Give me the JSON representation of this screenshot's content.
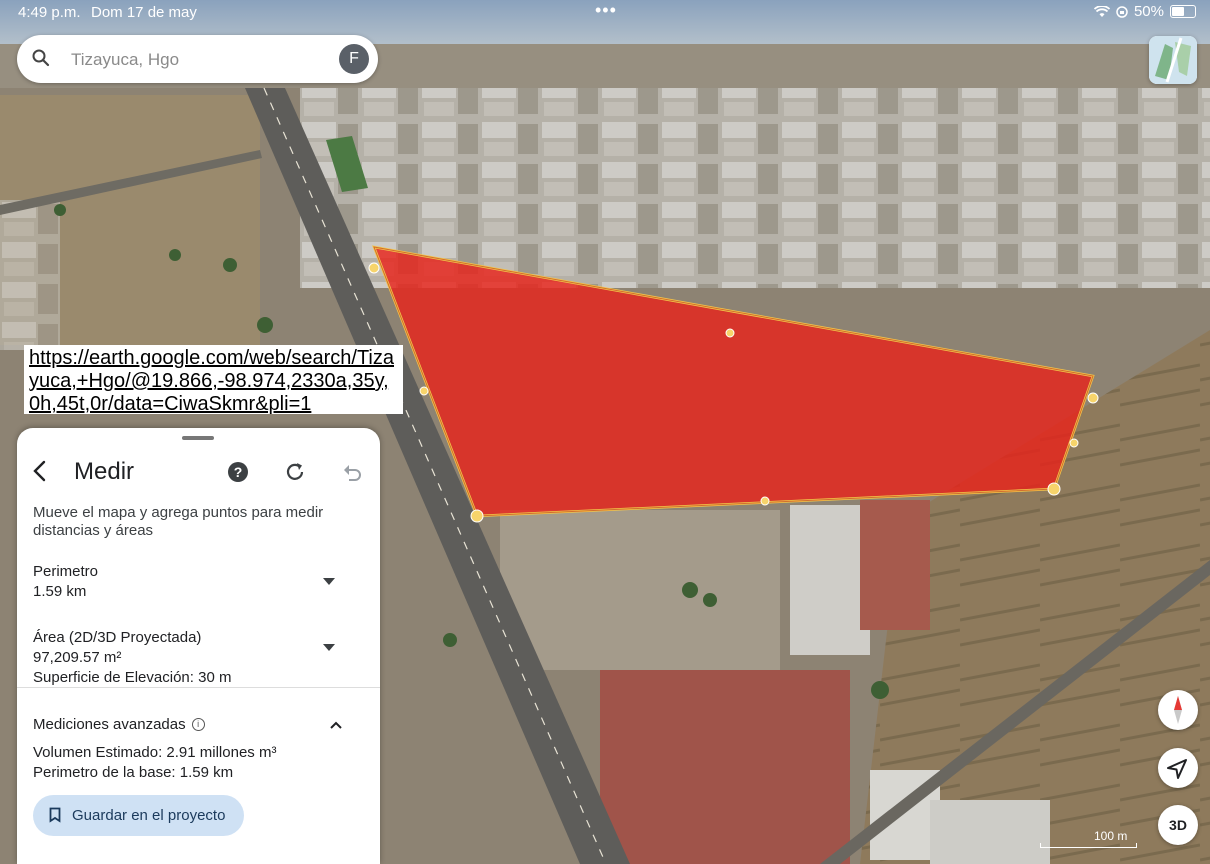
{
  "status_bar": {
    "time": "4:49 p.m.",
    "date": "Dom 17 de may",
    "battery": "50%",
    "more_dots": "•••"
  },
  "search": {
    "placeholder": "Tizayuca, Hgo",
    "avatar_letter": "F"
  },
  "url_overlay": "https://earth.google.com/web/search/Tizayuca,+Hgo/@19.866,-98.974,2330a,35y,0h,45t,0r/data=CiwaSkmr&pli=1",
  "panel": {
    "title": "Medir",
    "hint": "Mueve el mapa y agrega puntos para medir distancias y áreas",
    "perimeter_label": "Perimetro",
    "perimeter_value": "1.59 km",
    "area_label": "Área (2D/3D Proyectada)",
    "area_value": "97,209.57 m²",
    "elevation_surface": "Superficie de Elevación: 30 m",
    "advanced_label": "Mediciones avanzadas",
    "volume": "Volumen Estimado: 2.91 millones m³",
    "base_perimeter": "Perimetro de la base: 1.59 km",
    "save_label": "Guardar en el proyecto"
  },
  "map_controls": {
    "three_d_label": "3D",
    "scale_label": "100 m"
  },
  "colors": {
    "polygon_fill": "#e8231b",
    "polygon_edge": "#f4c64a",
    "save_button_bg": "#cfe1f4"
  }
}
